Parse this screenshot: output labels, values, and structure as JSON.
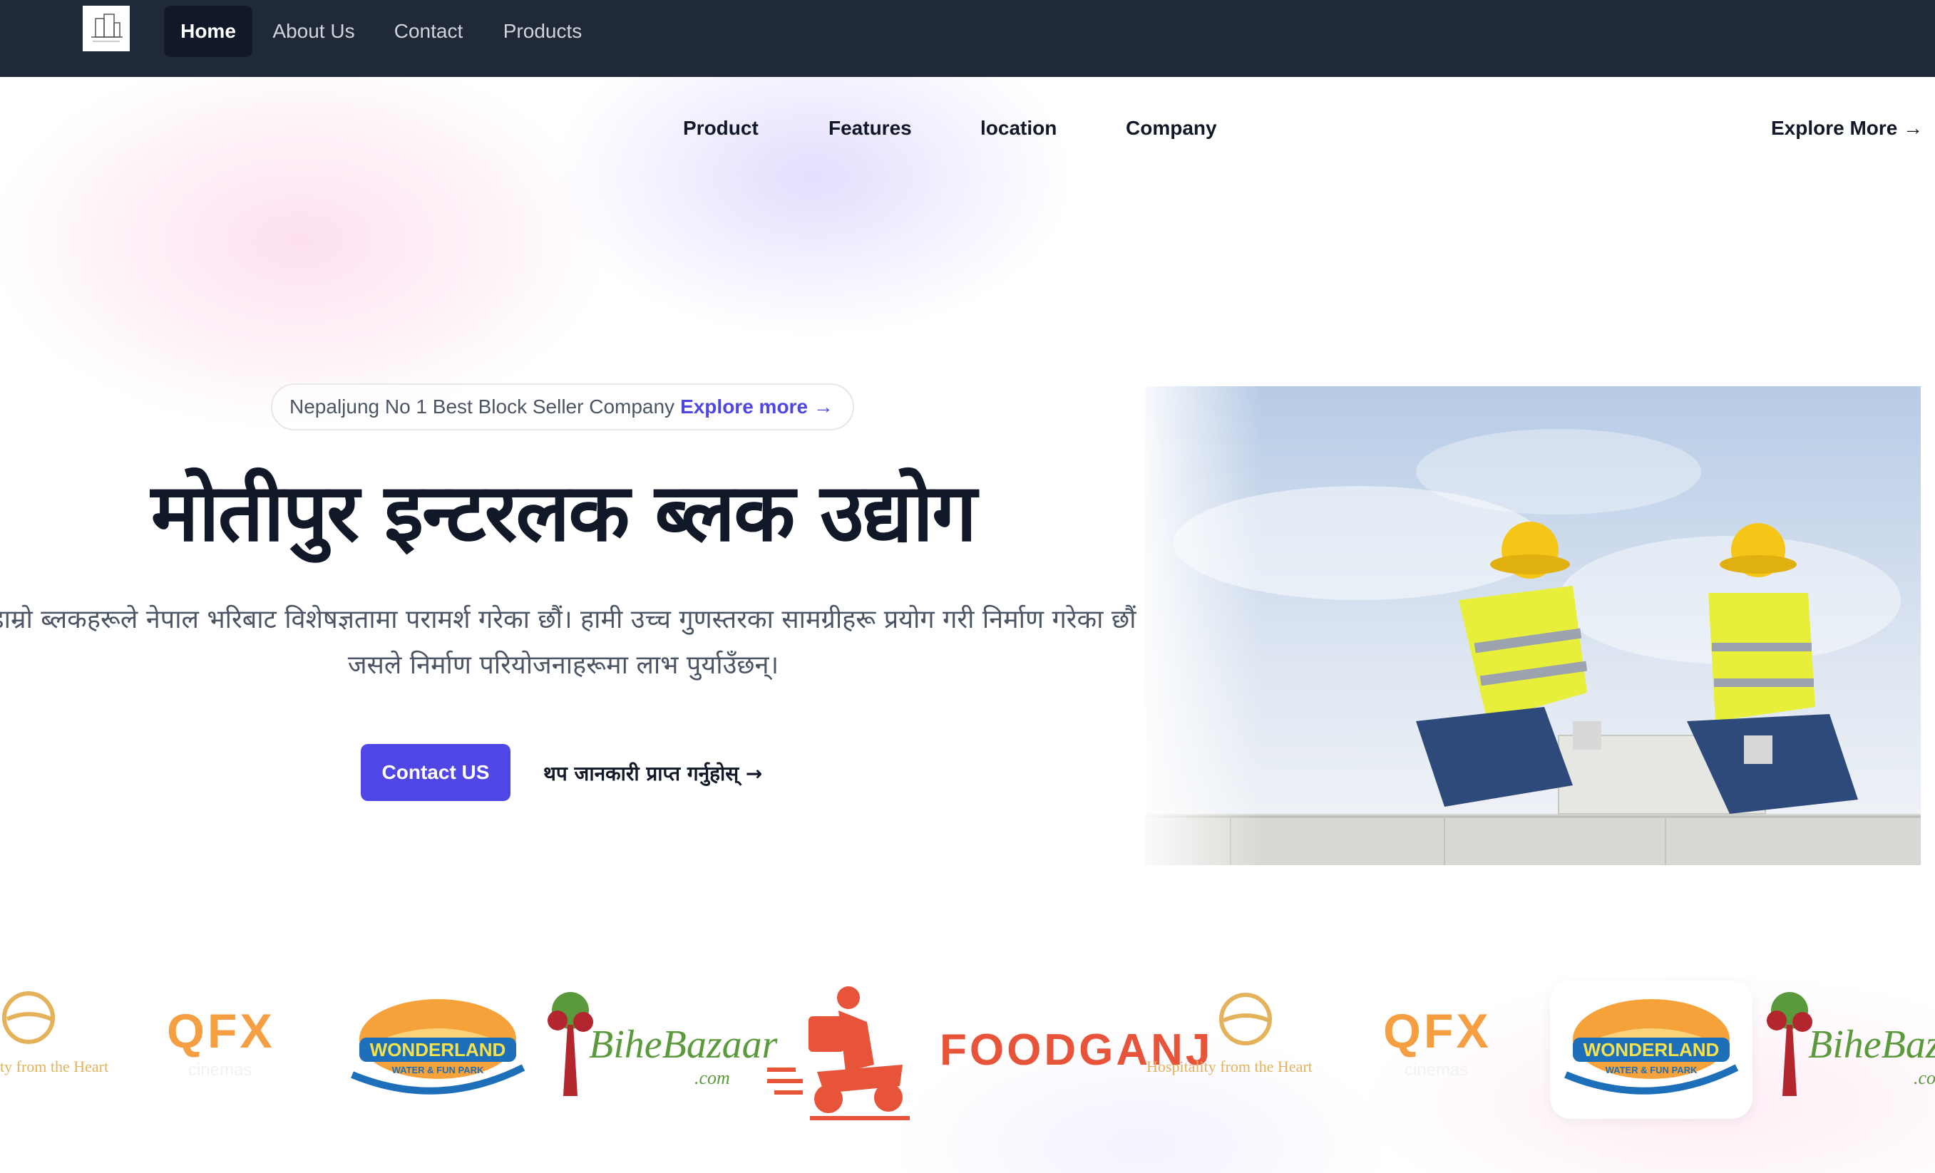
{
  "topnav": {
    "items": [
      {
        "label": "Home",
        "active": true
      },
      {
        "label": "About Us",
        "active": false
      },
      {
        "label": "Contact",
        "active": false
      },
      {
        "label": "Products",
        "active": false
      }
    ]
  },
  "subnav": {
    "items": [
      "Product",
      "Features",
      "location",
      "Company"
    ],
    "explore_label": "Explore More →"
  },
  "hero": {
    "pill_text": "Nepaljung No 1 Best Block Seller Company",
    "pill_link": "Explore more →",
    "title": "मोतीपुर इन्टरलक ब्लक उद्योग",
    "description": "हाम्रो ब्लकहरूले नेपाल भरिबाट विशेषज्ञतामा परामर्श गरेका छौं। हामी उच्च गुणस्तरका सामग्रीहरू प्रयोग गरी निर्माण गरेका छौं जसले निर्माण परियोजनाहरूमा लाभ पुर्याउँछन्।",
    "contact_button": "Contact US",
    "more_link": "थप जानकारी प्राप्त गर्नुहोस् →"
  },
  "partners": {
    "hospitality_tagline": "Hospitality from the Heart",
    "tagline_clipped": "ty from the Heart",
    "qfx_word": "QFX",
    "qfx_sub": "cinemas",
    "wonderland_word": "WONDERLAND",
    "wonderland_sub": "WATER & FUN PARK",
    "bihe_word": "BiheBazaar",
    "bihe_sub": ".com",
    "foodganj_word": "FOODGANJ"
  },
  "colors": {
    "topbar": "#1f2937",
    "accent": "#4f46e5",
    "foodganj": "#e8543a",
    "hospitality": "#e3b25a",
    "qfx_orange": "#f59e42",
    "bihe_green": "#5a9a3c",
    "bihe_red": "#b3262d"
  },
  "icons": [
    "building-logo-icon",
    "arrow-right-icon"
  ]
}
